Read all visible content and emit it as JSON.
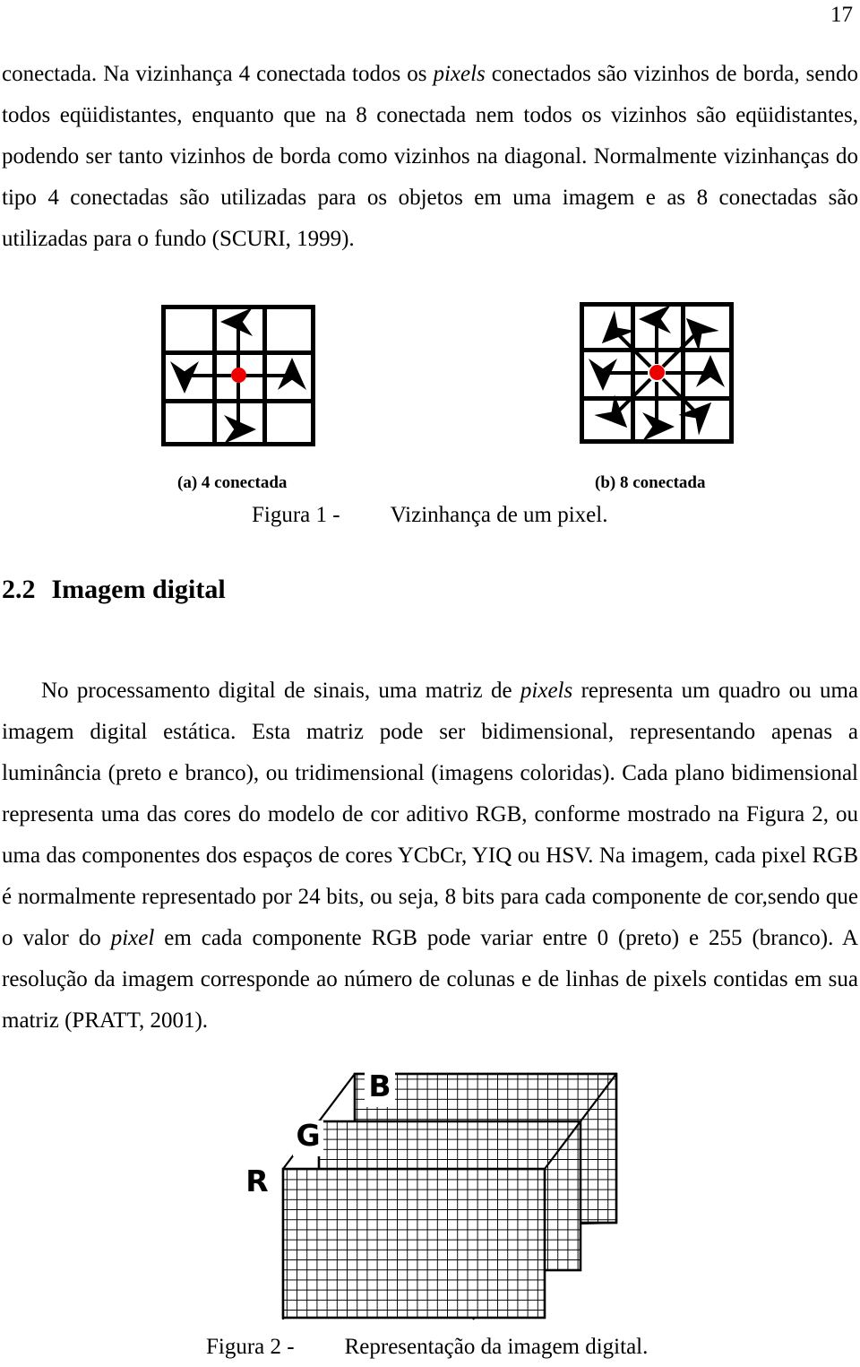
{
  "page": {
    "number": "17"
  },
  "paragraphs": {
    "p1_part1": "conectada. ",
    "p1_part2": "Na vizinhança 4 conectada todos os ",
    "p1_italic1": "pixels",
    "p1_part3": " conectados são vizinhos de borda, sendo todos eqüidistantes, enquanto que na 8 conectada nem todos os vizinhos são eqüidistantes, podendo ser tanto vizinhos de borda como vizinhos na diagonal. Normalmente vizinhanças do tipo 4 conectadas são utilizadas para os objetos em uma imagem e as 8 conectadas são utilizadas para o fundo (SCURI, 1999).",
    "p2_part1": "No processamento digital de sinais, uma matriz de ",
    "p2_italic1": "pixels",
    "p2_part2": " representa um quadro ou uma imagem digital estática. Esta matriz pode ser bidimensional, representando apenas a luminância (preto e branco), ou tridimensional (imagens coloridas). Cada plano bidimensional representa uma das cores do modelo de cor aditivo RGB, conforme mostrado na Figura 2, ou uma das componentes dos espaços de cores YCbCr, YIQ ou HSV. Na imagem, cada pixel RGB é normalmente representado por 24 bits, ou seja, 8 bits para cada componente de cor,sendo que o valor do ",
    "p2_italic2": "pixel",
    "p2_part3": " em cada componente RGB pode variar entre 0 (preto) e 255 (branco). A resolução da imagem corresponde ao número de colunas e de linhas de pixels contidas em sua matriz (PRATT, 2001)."
  },
  "section": {
    "number": "2.2",
    "title": "Imagem digital"
  },
  "figure1": {
    "subcaption_a": "(a) 4 conectada",
    "subcaption_b": "(b) 8 conectada",
    "caption_label": "Figura 1 -",
    "caption_text": "Vizinhança de um pixel.",
    "dot_color": "#ee0000",
    "line_color": "#000000"
  },
  "figure2": {
    "plane_b": "B",
    "plane_g": "G",
    "plane_r": "R",
    "caption_label": "Figura 2 -",
    "caption_text": "Representação da imagem digital.",
    "line_color": "#000000"
  }
}
